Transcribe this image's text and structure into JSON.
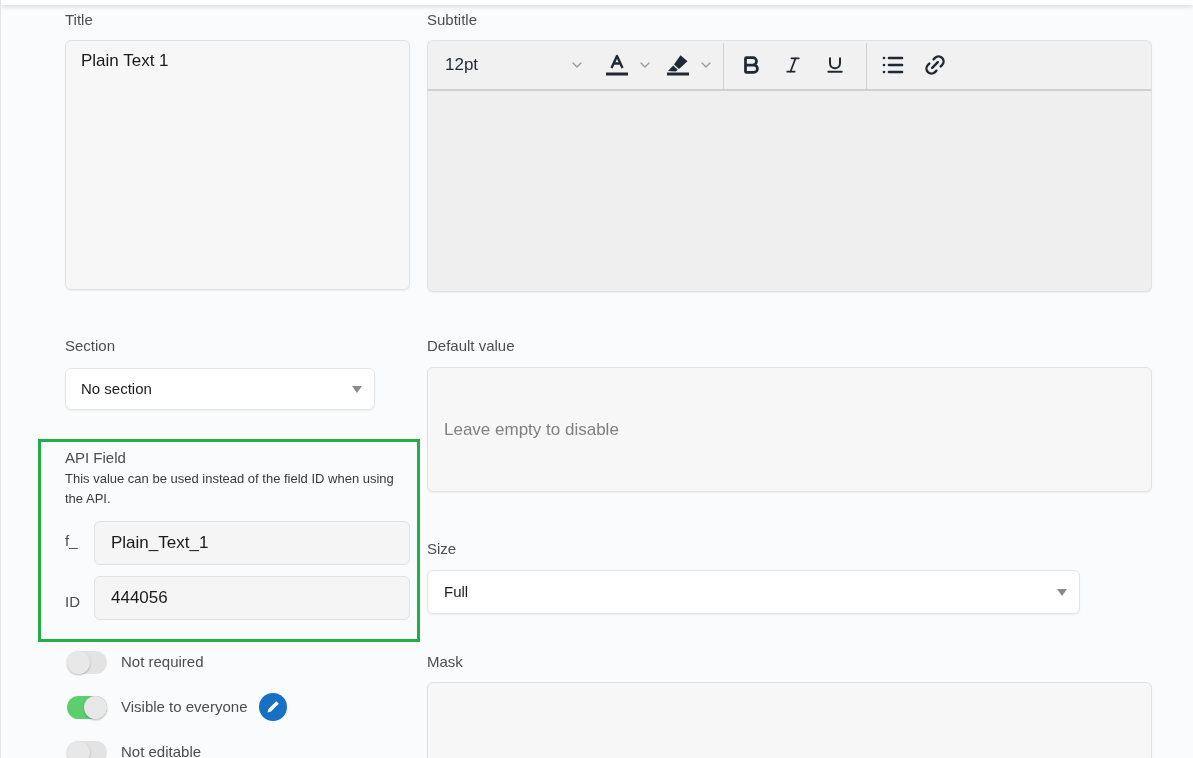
{
  "title_field": {
    "label": "Title",
    "value": "Plain Text 1"
  },
  "subtitle_field": {
    "label": "Subtitle",
    "font_size": "12pt"
  },
  "section_field": {
    "label": "Section",
    "value": "No section"
  },
  "default_value_field": {
    "label": "Default value",
    "placeholder": "Leave empty to disable"
  },
  "api_field": {
    "label": "API Field",
    "description": "This value can be used instead of the field ID when using the API.",
    "highlighted": true,
    "inputs": [
      {
        "prefix": "f_",
        "value": "Plain_Text_1"
      },
      {
        "prefix": "ID",
        "value": "444056"
      }
    ]
  },
  "size_field": {
    "label": "Size",
    "value": "Full"
  },
  "mask_field": {
    "label": "Mask"
  },
  "toggles": [
    {
      "label": "Not required",
      "on": false,
      "edit_button": false
    },
    {
      "label": "Visible to everyone",
      "on": true,
      "edit_button": true
    },
    {
      "label": "Not editable",
      "on": false,
      "edit_button": false
    }
  ]
}
